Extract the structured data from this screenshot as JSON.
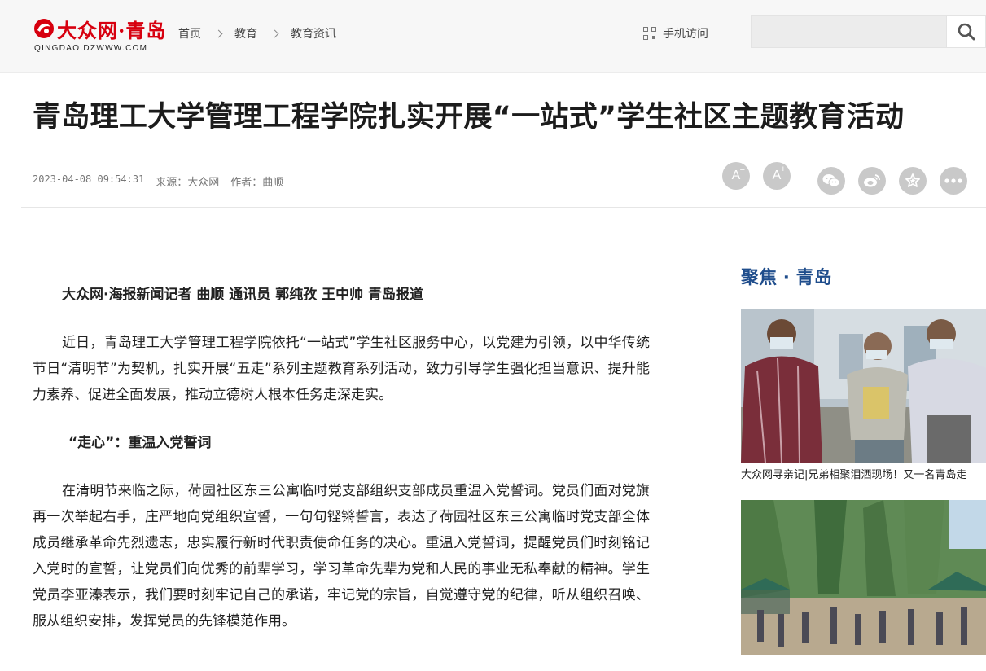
{
  "site": {
    "logo_text": "大众网·青岛",
    "logo_domain": "QINGDAO.DZWWW.COM"
  },
  "breadcrumb": [
    "首页",
    "教育",
    "教育资讯"
  ],
  "header": {
    "mobile_label": "手机访问",
    "search_value": ""
  },
  "article": {
    "title": "青岛理工大学管理工程学院扎实开展“一站式”学生社区主题教育活动",
    "time": "2023-04-08 09:54:31",
    "source": "来源：大众网",
    "author": "作者：曲顺",
    "lead": "大众网·海报新闻记者 曲顺 通讯员 郭纯孜 王中帅 青岛报道",
    "p1": "近日，青岛理工大学管理工程学院依托“一站式”学生社区服务中心，以党建为引领，以中华传统节日“清明节”为契机，扎实开展“五走”系列主题教育系列活动，致力引导学生强化担当意识、提升能力素养、促进全面发展，推动立德树人根本任务走深走实。",
    "sub1": "“走心”：重温入党誓词",
    "p2": "在清明节来临之际，荷园社区东三公寓临时党支部组织支部成员重温入党誓词。党员们面对党旗再一次举起右手，庄严地向党组织宣誓，一句句铿锵誓言，表达了荷园社区东三公寓临时党支部全体成员继承革命先烈遗志，忠实履行新时代职责使命任务的决心。重温入党誓词，提醒党员们时刻铭记入党时的宣誓，让党员们向优秀的前辈学习，学习革命先辈为党和人民的事业无私奉献的精神。学生党员李亚溱表示，我们要时刻牢记自己的承诺，牢记党的宗旨，自觉遵守党的纪律，听从组织召唤、服从组织安排，发挥党员的先锋模范作用。"
  },
  "tools": {
    "font_dec": "A",
    "font_inc": "A"
  },
  "sidebar": {
    "title": "聚焦 · 青岛",
    "cards": [
      {
        "caption": "大众网寻亲记|兄弟相聚泪洒现场！又一名青岛走"
      },
      {
        "caption": ""
      }
    ]
  },
  "colors": {
    "brand_red": "#d7000f",
    "sidebar_title": "#1f4d8c",
    "tool_gray": "#c9c9c9"
  }
}
